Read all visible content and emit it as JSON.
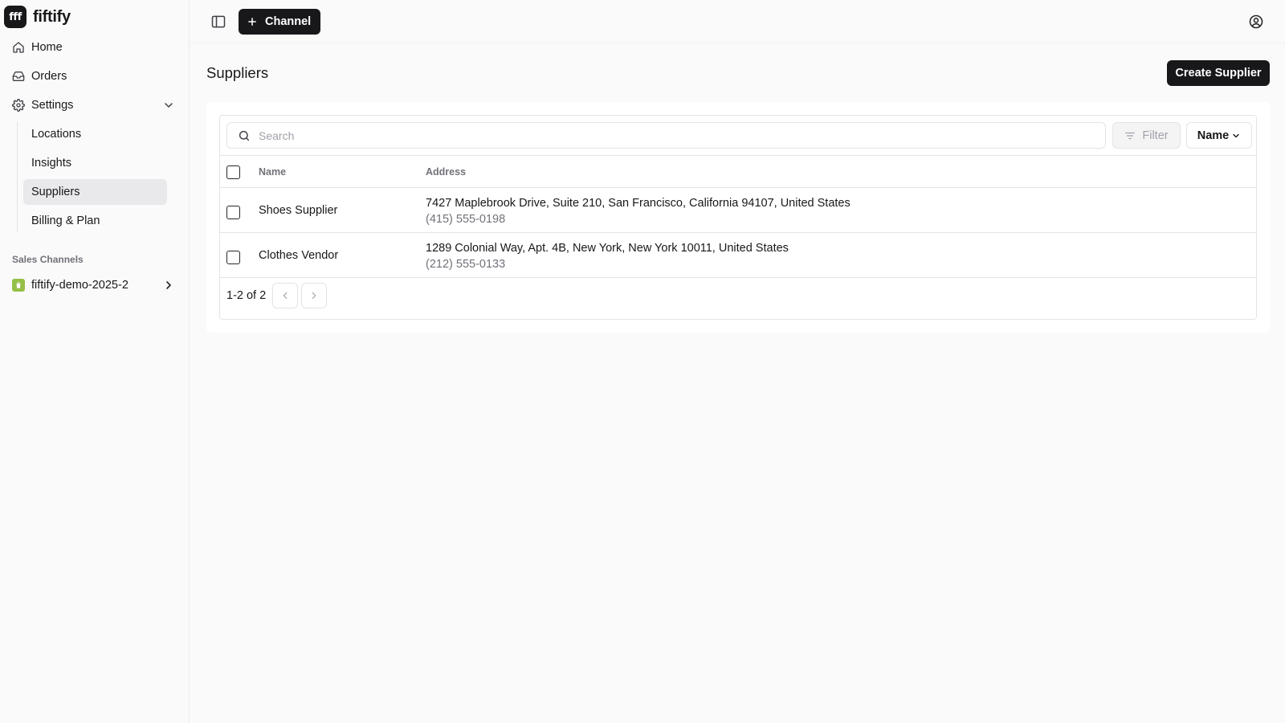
{
  "brand": {
    "logo_text": "fff",
    "name": "fiftify"
  },
  "sidebar": {
    "items": [
      {
        "label": "Home",
        "icon": "home-icon"
      },
      {
        "label": "Orders",
        "icon": "inbox-icon"
      },
      {
        "label": "Settings",
        "icon": "gear-icon"
      }
    ],
    "settings_sub": [
      {
        "label": "Locations"
      },
      {
        "label": "Insights"
      },
      {
        "label": "Suppliers",
        "active": true
      },
      {
        "label": "Billing & Plan"
      }
    ],
    "section_label": "Sales Channels",
    "channel": {
      "label": "fiftify-demo-2025-2",
      "icon": "shopify-icon"
    }
  },
  "topbar": {
    "channel_button": "Channel"
  },
  "page": {
    "title": "Suppliers",
    "create_button": "Create Supplier"
  },
  "table": {
    "search_placeholder": "Search",
    "filter_label": "Filter",
    "sort_label": "Name",
    "columns": [
      "Name",
      "Address"
    ],
    "rows": [
      {
        "name": "Shoes Supplier",
        "address": "7427 Maplebrook Drive, Suite 210, San Francisco, California 94107, United States",
        "phone": "(415) 555-0198"
      },
      {
        "name": "Clothes Vendor",
        "address": "1289 Colonial Way, Apt. 4B, New York, New York 10011, United States",
        "phone": "(212) 555-0133"
      }
    ],
    "pagination": "1-2 of 2"
  },
  "colors": {
    "primary": "#18181b",
    "active_bg": "#e9e9eb",
    "shop_green": "#95bf47"
  }
}
